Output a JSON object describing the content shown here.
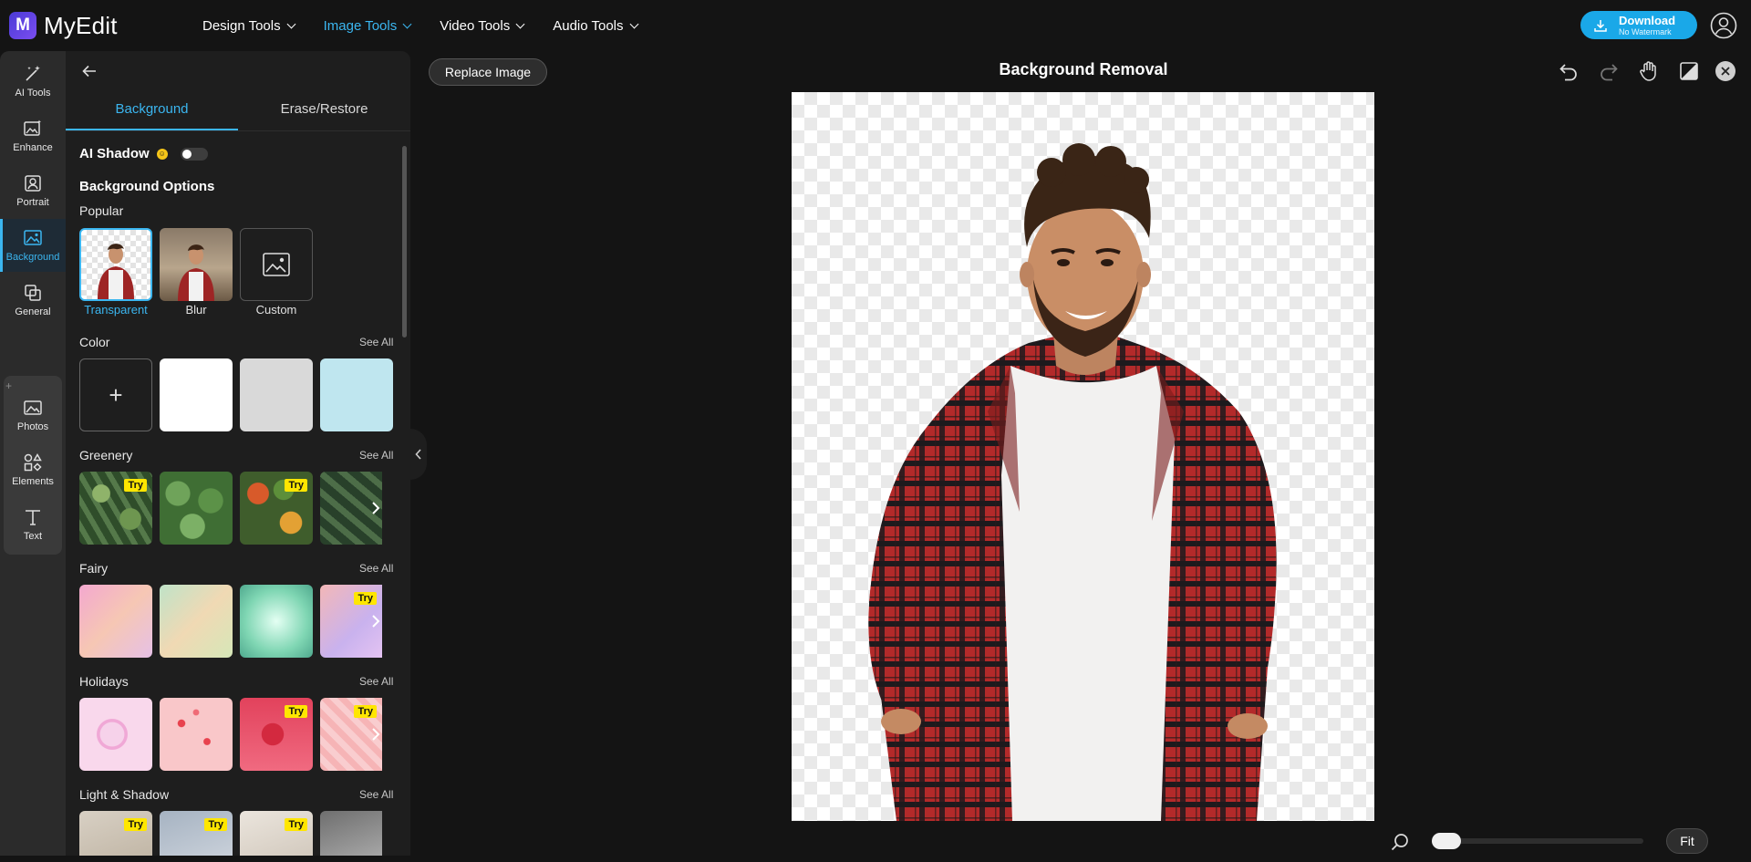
{
  "app": {
    "logo_letter": "M",
    "name": "MyEdit"
  },
  "topnav": [
    {
      "label": "Design Tools",
      "active": false
    },
    {
      "label": "Image Tools",
      "active": true
    },
    {
      "label": "Video Tools",
      "active": false
    },
    {
      "label": "Audio Tools",
      "active": false
    }
  ],
  "download": {
    "label": "Download",
    "sublabel": "No Watermark"
  },
  "rail": [
    {
      "label": "AI Tools",
      "icon": "magic-wand-icon"
    },
    {
      "label": "Enhance",
      "icon": "enhance-image-icon"
    },
    {
      "label": "Portrait",
      "icon": "portrait-icon"
    },
    {
      "label": "Background",
      "icon": "background-icon",
      "active": true
    },
    {
      "label": "General",
      "icon": "general-icon"
    },
    {
      "label": "Photos",
      "icon": "photos-icon"
    },
    {
      "label": "Elements",
      "icon": "elements-icon"
    },
    {
      "label": "Text",
      "icon": "text-icon"
    }
  ],
  "rail_plus": "+",
  "panel": {
    "tabs": [
      {
        "label": "Background",
        "active": true
      },
      {
        "label": "Erase/Restore",
        "active": false
      }
    ],
    "ai_shadow": {
      "label": "AI Shadow",
      "badge": "☺",
      "enabled": false
    },
    "background_options_title": "Background Options",
    "popular": {
      "title": "Popular",
      "items": [
        {
          "label": "Transparent",
          "selected": true
        },
        {
          "label": "Blur"
        },
        {
          "label": "Custom"
        }
      ]
    },
    "color": {
      "title": "Color",
      "see_all": "See All",
      "add_label": "+",
      "swatches": [
        "#ffffff",
        "#d9d9d9",
        "#bfe6ef"
      ]
    },
    "greenery": {
      "title": "Greenery",
      "see_all": "See All",
      "try_label": "Try"
    },
    "fairy": {
      "title": "Fairy",
      "see_all": "See All",
      "try_label": "Try"
    },
    "holidays": {
      "title": "Holidays",
      "see_all": "See All",
      "try_label": "Try"
    },
    "light_shadow": {
      "title": "Light & Shadow",
      "see_all": "See All",
      "try_label": "Try"
    }
  },
  "canvas": {
    "replace_label": "Replace Image",
    "title": "Background Removal"
  },
  "zoom": {
    "fit_label": "Fit"
  },
  "colors": {
    "accent": "#3bb6f0",
    "download_bg": "#1aa8e8",
    "try_badge": "#ffe600",
    "shirt_red": "#b32a2a"
  }
}
